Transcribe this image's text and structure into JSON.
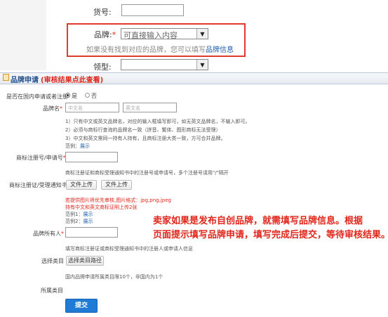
{
  "top": {
    "sku_label": "货号:",
    "brand_label": "品牌:",
    "brand_required": "*",
    "brand_placeholder": "可直接输入内容",
    "brand_hint_prefix": "如果没有找到对应的品牌，您可以填写",
    "brand_hint_link": "品牌信息",
    "collar_label": "领型:"
  },
  "section": {
    "title": "品牌申请",
    "review_link": "(审核结果点此查看)"
  },
  "form": {
    "domestic_label": "是否在国内申请或者注册",
    "yes_label": "是",
    "no_label": "否",
    "brand_name_label": "品牌名",
    "cn_placeholder": "中文名",
    "en_placeholder": "英文名",
    "brand_notes": [
      "1）只有中文或英文品牌名，对应的输入框填写即可，如无英文品牌名，不输入即可。",
      "2）必须与商标行查询的品牌名一致（拼音、繁体、图形商标无法受理）",
      "3）中文和英文需同一持有人持有，且商标注册大类一致，方可合并品牌。"
    ],
    "example_label": "范例：",
    "example_link": "展示",
    "trademark_no_label": "商标注册号/申请号",
    "trademark_no_hint": "商标注册证和商标受理通知书中的注册号或申请号，多个注册号请用\"/\"隔开",
    "certificate_label": "商标注册证/受理通知书",
    "upload_button_1": "文件上传",
    "upload_button_2": "文件上传",
    "upload_red_1": "若提供图片将优先审核,图片格式：jpg,png,jpeg",
    "upload_red_2": "持有中文和英文商标证明上传2张",
    "example_1_label": "范例1：",
    "example_1_link": "展示",
    "example_2_label": "范例2：",
    "example_2_link": "展示",
    "owner_label": "品牌所有人",
    "owner_hint": "填写商标注册证或商标受理通知书中的注册人或申请人信息",
    "category_label": "选择类目",
    "category_button": "选择类目路径",
    "category_hint": "国内品牌申请所属类目限10个，非国内为1个",
    "belong_label": "所属类目",
    "submit_label": "提交"
  },
  "annotation": {
    "line1": "卖家如果是发布自创品牌，就需填写品牌信息。根据",
    "line2": "页面提示填写品牌申请，填写完成后提交，等待审核结果。"
  },
  "colors": {
    "accent_red": "#e0261b",
    "link_blue": "#1f5fb0",
    "submit_blue": "#1f7bd3"
  }
}
